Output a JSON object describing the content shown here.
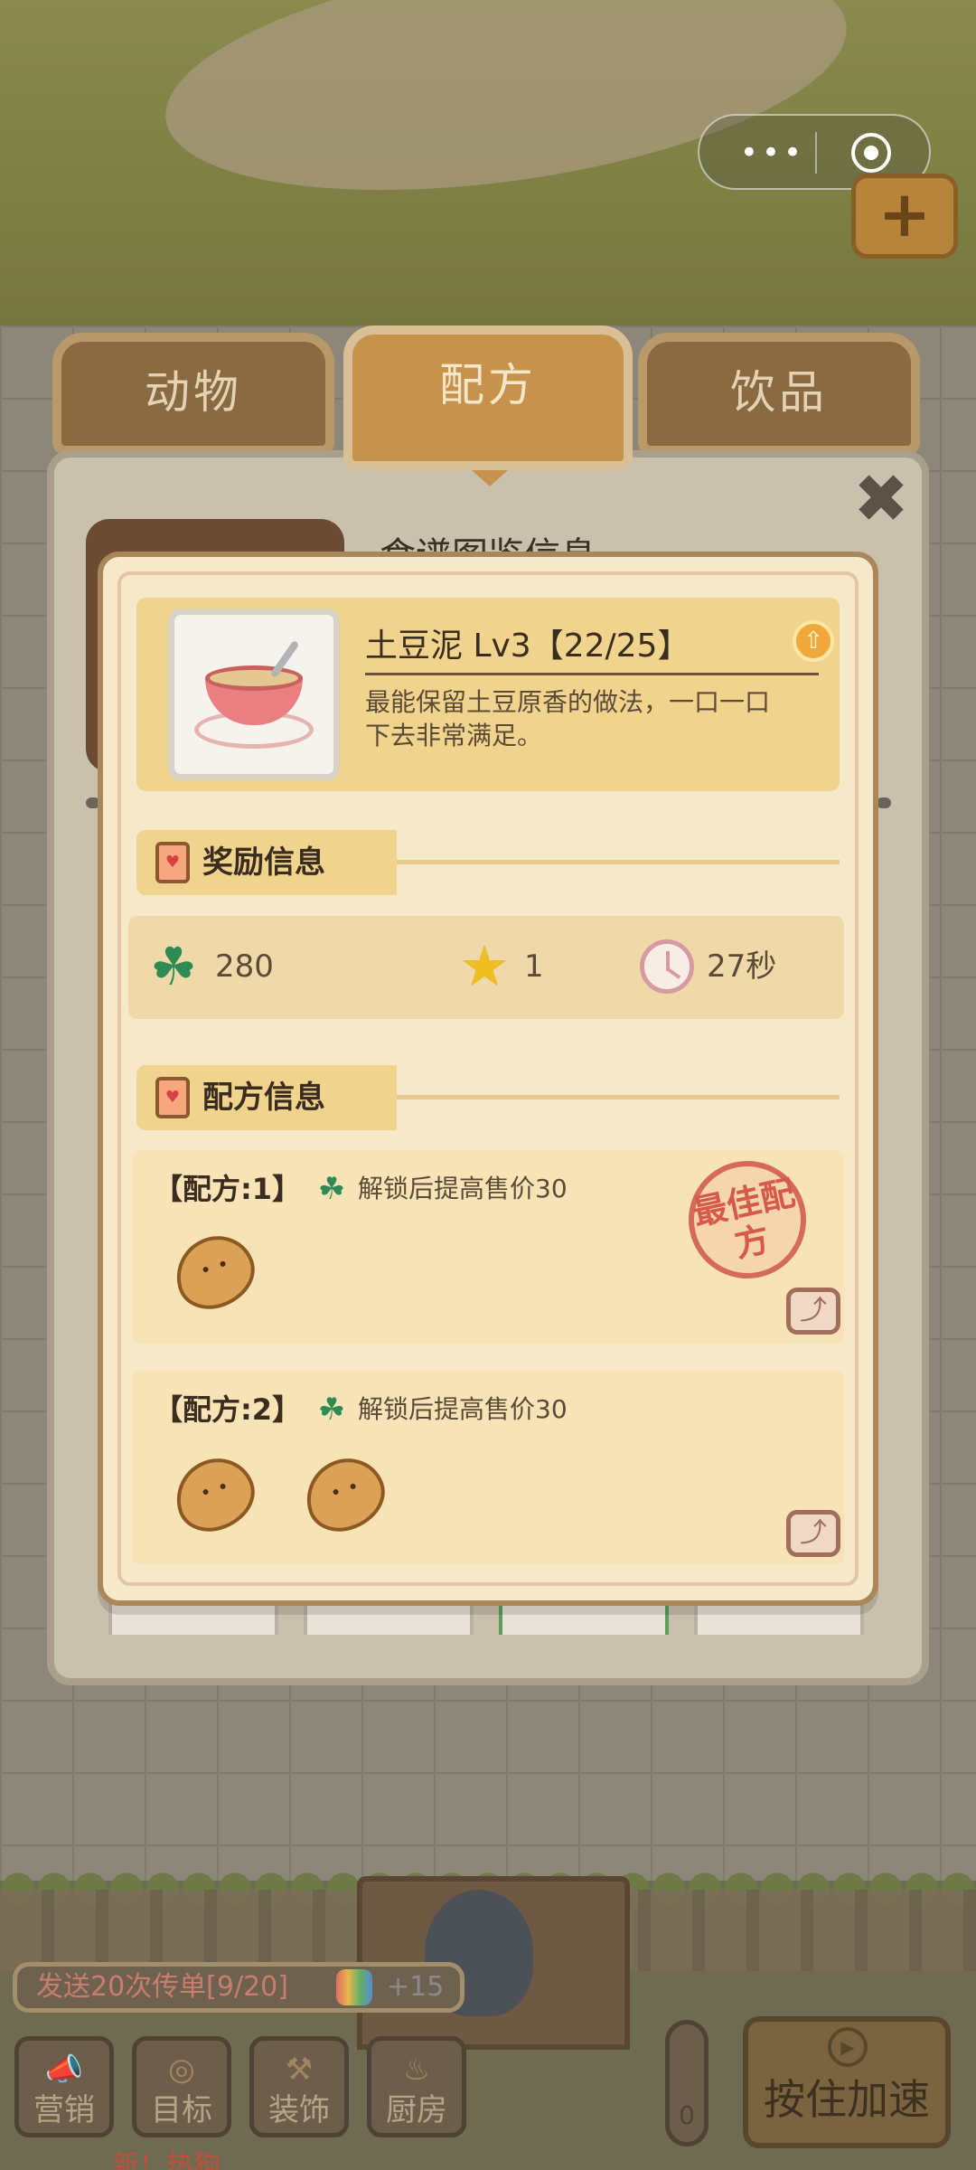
{
  "system": {
    "menu_dots": "•••"
  },
  "tabs": [
    {
      "label": "动物",
      "active": false
    },
    {
      "label": "配方",
      "active": true
    },
    {
      "label": "饮品",
      "active": false
    }
  ],
  "panel": {
    "title_partial": "食谱图鉴信息",
    "close_symbol": "✖"
  },
  "item": {
    "name": "土豆泥 Lv3【22/25】",
    "description": "最能保留土豆原香的做法，一口一口下去非常满足。"
  },
  "rewards_section": {
    "title": "奖励信息",
    "clover_value": "280",
    "star_value": "1",
    "time_value": "27秒"
  },
  "recipes_section": {
    "title": "配方信息",
    "recipes": [
      {
        "label": "【配方:1】",
        "bonus": "解锁后提高售价30",
        "ingredient_count": 1,
        "best": true
      },
      {
        "label": "【配方:2】",
        "bonus": "解锁后提高售价30",
        "ingredient_count": 2,
        "best": false
      }
    ],
    "best_stamp": "最佳配方"
  },
  "icons": {
    "clover": "☘",
    "star": "★",
    "share": "⤴",
    "upgrade": "⇧"
  },
  "bottom": {
    "task_text": "发送20次传单[9/20]",
    "task_reward": "+15",
    "buttons": [
      {
        "label": "营销",
        "icon": "📣"
      },
      {
        "label": "目标",
        "icon": "◎"
      },
      {
        "label": "装饰",
        "icon": "⚒"
      },
      {
        "label": "厨房",
        "icon": "♨"
      }
    ],
    "thermo_value": "0",
    "speed_label": "按住加速",
    "new_hint": "新！热狗"
  },
  "colors": {
    "panel_bg": "#c9c0ae",
    "modal_bg": "#f5e9c9",
    "accent_gold": "#f0d48e",
    "tab_active": "#c7924c",
    "clover_green": "#2f8a55"
  }
}
